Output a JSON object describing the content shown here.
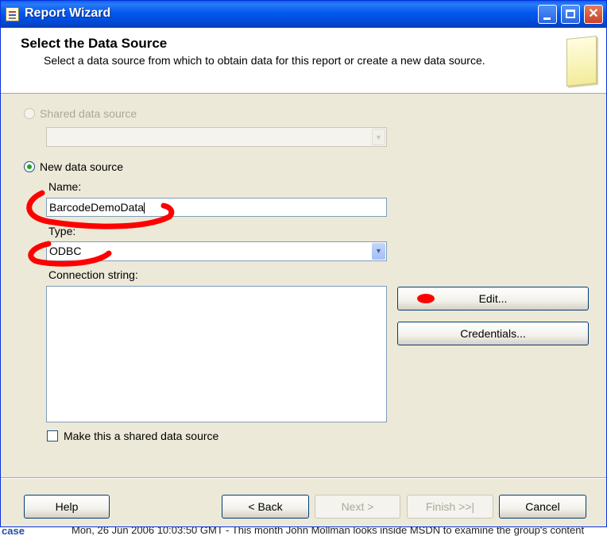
{
  "window": {
    "title": "Report Wizard"
  },
  "header": {
    "title": "Select the Data Source",
    "subtitle": "Select a data source from which to obtain data for this report or create a new data source."
  },
  "shared": {
    "label": "Shared data source",
    "value": ""
  },
  "new_source": {
    "label": "New data source",
    "name_label": "Name:",
    "name_value": "BarcodeDemoData",
    "type_label": "Type:",
    "type_value": "ODBC",
    "conn_label": "Connection string:",
    "conn_value": ""
  },
  "side_buttons": {
    "edit": "Edit...",
    "credentials": "Credentials..."
  },
  "make_shared": {
    "label": "Make this a shared data source"
  },
  "footer": {
    "help": "Help",
    "back": "< Back",
    "next": "Next >",
    "finish": "Finish >>|",
    "cancel": "Cancel"
  },
  "background_text": {
    "left": "case",
    "line": "Mon, 26 Jun 2006 10:03:50 GMT - This month John Mollman looks inside MSDN to examine the group's content"
  },
  "colors": {
    "title_bar": "#0058ee",
    "annotation": "#ff0000",
    "dialog_bg": "#ece9d8"
  }
}
